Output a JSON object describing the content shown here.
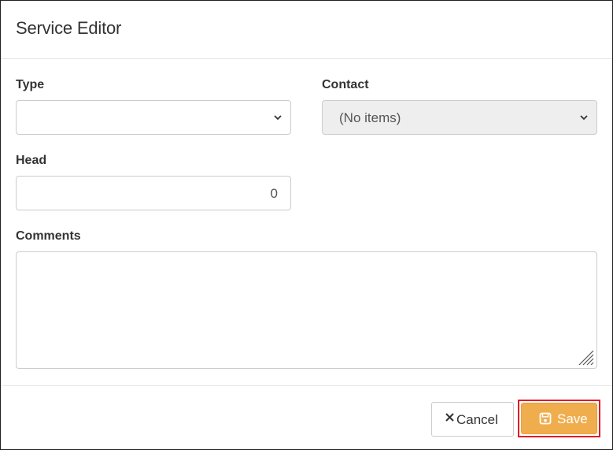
{
  "modal": {
    "title": "Service Editor"
  },
  "form": {
    "type": {
      "label": "Type",
      "value": ""
    },
    "contact": {
      "label": "Contact",
      "value": "(No items)"
    },
    "head": {
      "label": "Head",
      "value": "0"
    },
    "comments": {
      "label": "Comments",
      "value": ""
    }
  },
  "footer": {
    "cancel_label": "Cancel",
    "save_label": "Save"
  },
  "icons": {
    "cancel": "close-icon",
    "save": "floppy-disk-icon",
    "dropdown": "chevron-down-icon"
  },
  "colors": {
    "save_button": "#f0ad4e",
    "save_highlight_border": "#e3172b",
    "disabled_field": "#eeeeee"
  }
}
